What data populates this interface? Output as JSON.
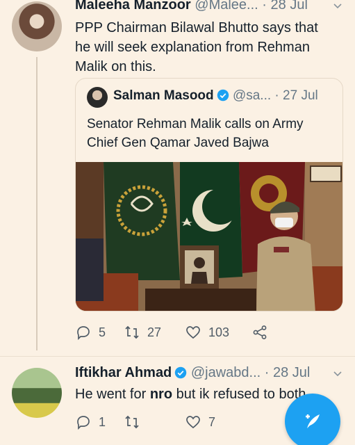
{
  "tweets": [
    {
      "author_name": "Maleeha Manzoor",
      "handle": "@Malee...",
      "separator": "·",
      "time": "28 Jul",
      "text_lines": [
        "PPP Chairman Bilawal Bhutto says that",
        "he will seek explanation from Rehman",
        "Malik on this."
      ],
      "quote": {
        "author_name": "Salman Masood",
        "handle": "@sa...",
        "separator": "·",
        "time": "27 Jul",
        "text_lines": [
          "Senator Rehman Malik calls on Army",
          "Chief Gen Qamar Javed Bajwa"
        ]
      },
      "stats": {
        "replies": "5",
        "retweets": "27",
        "likes": "103"
      }
    },
    {
      "author_name": "Iftikhar Ahmad",
      "handle": "@jawabd...",
      "separator": "·",
      "time": "28 Jul",
      "text_before": "He went for ",
      "text_bold": "nro",
      "text_after": " but ik refused to both",
      "stats": {
        "replies": "1",
        "retweets": "",
        "likes": "7"
      }
    }
  ],
  "icons": {
    "reply": "reply-icon",
    "retweet": "retweet-icon",
    "like": "heart-icon",
    "share": "share-icon",
    "verified": "verified-badge-icon",
    "compose": "compose-tweet-icon"
  },
  "colors": {
    "background": "#fbf1e4",
    "accent": "#1da1f2",
    "text": "#15202b",
    "muted": "#657786"
  }
}
